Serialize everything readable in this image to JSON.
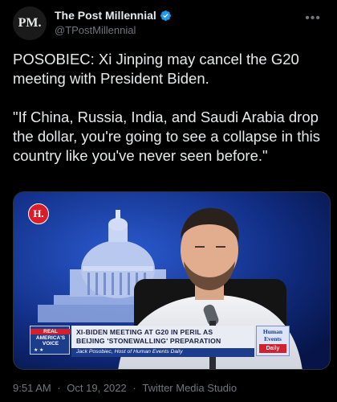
{
  "author": {
    "avatar_text": "PM.",
    "display_name": "The Post Millennial",
    "handle": "@TPostMillennial",
    "verified": true
  },
  "tweet": {
    "paragraphs": [
      "POSOBIEC: Xi Jinping may cancel the G20 meeting with President Biden.",
      "\"If China, Russia, India, and Saudi Arabia drop the dollar, you're going to see a collapse in this country like you've never seen before.\""
    ]
  },
  "media": {
    "logo_text": "H.",
    "chyron": {
      "tag_lines": [
        "REAL",
        "AMERICA'S",
        "VOICE"
      ],
      "tag_stars": "★ ★",
      "headline_lines": [
        "XI-BIDEN MEETING AT G20 IN PERIL AS",
        "BEIJING 'STONEWALLING' PREPARATION"
      ],
      "subline": "Jack Posobiec, Host of Human Events Daily",
      "badge_lines": [
        "Human",
        "Events",
        "Daily"
      ]
    }
  },
  "meta": {
    "time": "9:51 AM",
    "separator": "·",
    "date": "Oct 19, 2022",
    "source": "Twitter Media Studio"
  },
  "colors": {
    "background": "#000000",
    "text_primary": "#e7e9ea",
    "text_secondary": "#71767b",
    "verified_blue": "#1d9bf0",
    "chyron_blue": "#1c3c8c",
    "chyron_red": "#d3202e"
  },
  "icons": {
    "verified": "verified-badge-icon",
    "more": "more-options-icon"
  }
}
